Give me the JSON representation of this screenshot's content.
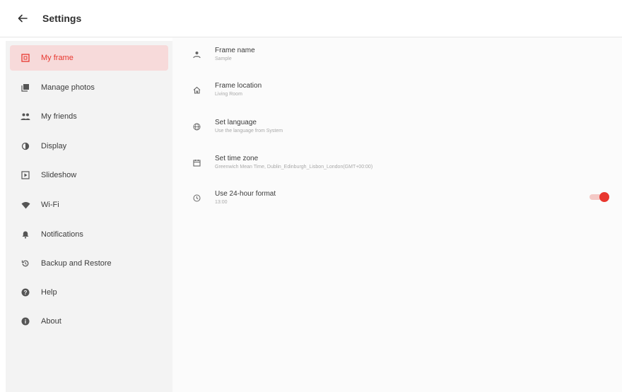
{
  "header": {
    "title": "Settings",
    "back_icon": "arrow-back-icon"
  },
  "theme": {
    "accent": "#e8372f",
    "active_bg": "#f7dada",
    "sidebar_bg": "#f3f3f3"
  },
  "sidebar": {
    "active_index": 0,
    "items": [
      {
        "label": "My frame",
        "icon": "frame-icon"
      },
      {
        "label": "Manage photos",
        "icon": "photos-icon"
      },
      {
        "label": "My friends",
        "icon": "friends-icon"
      },
      {
        "label": "Display",
        "icon": "brightness-icon"
      },
      {
        "label": "Slideshow",
        "icon": "slideshow-icon"
      },
      {
        "label": "Wi-Fi",
        "icon": "wifi-icon"
      },
      {
        "label": "Notifications",
        "icon": "bell-icon"
      },
      {
        "label": "Backup and Restore",
        "icon": "backup-icon"
      },
      {
        "label": "Help",
        "icon": "help-icon"
      },
      {
        "label": "About",
        "icon": "info-icon"
      }
    ]
  },
  "settings": {
    "frame_name": {
      "label": "Frame name",
      "value": "Sample",
      "icon": "person-icon"
    },
    "frame_location": {
      "label": "Frame location",
      "value": "Living Room",
      "icon": "home-icon"
    },
    "language": {
      "label": "Set language",
      "value": "Use the language from System",
      "icon": "globe-icon"
    },
    "time_zone": {
      "label": "Set time zone",
      "value": "Greenwich Mean Time, Dublin_Edinburgh_Lisbon_London(GMT+00:00)",
      "icon": "calendar-icon"
    },
    "time_format": {
      "label": "Use 24-hour format",
      "value": "13:00",
      "icon": "clock-icon",
      "enabled": true
    }
  }
}
